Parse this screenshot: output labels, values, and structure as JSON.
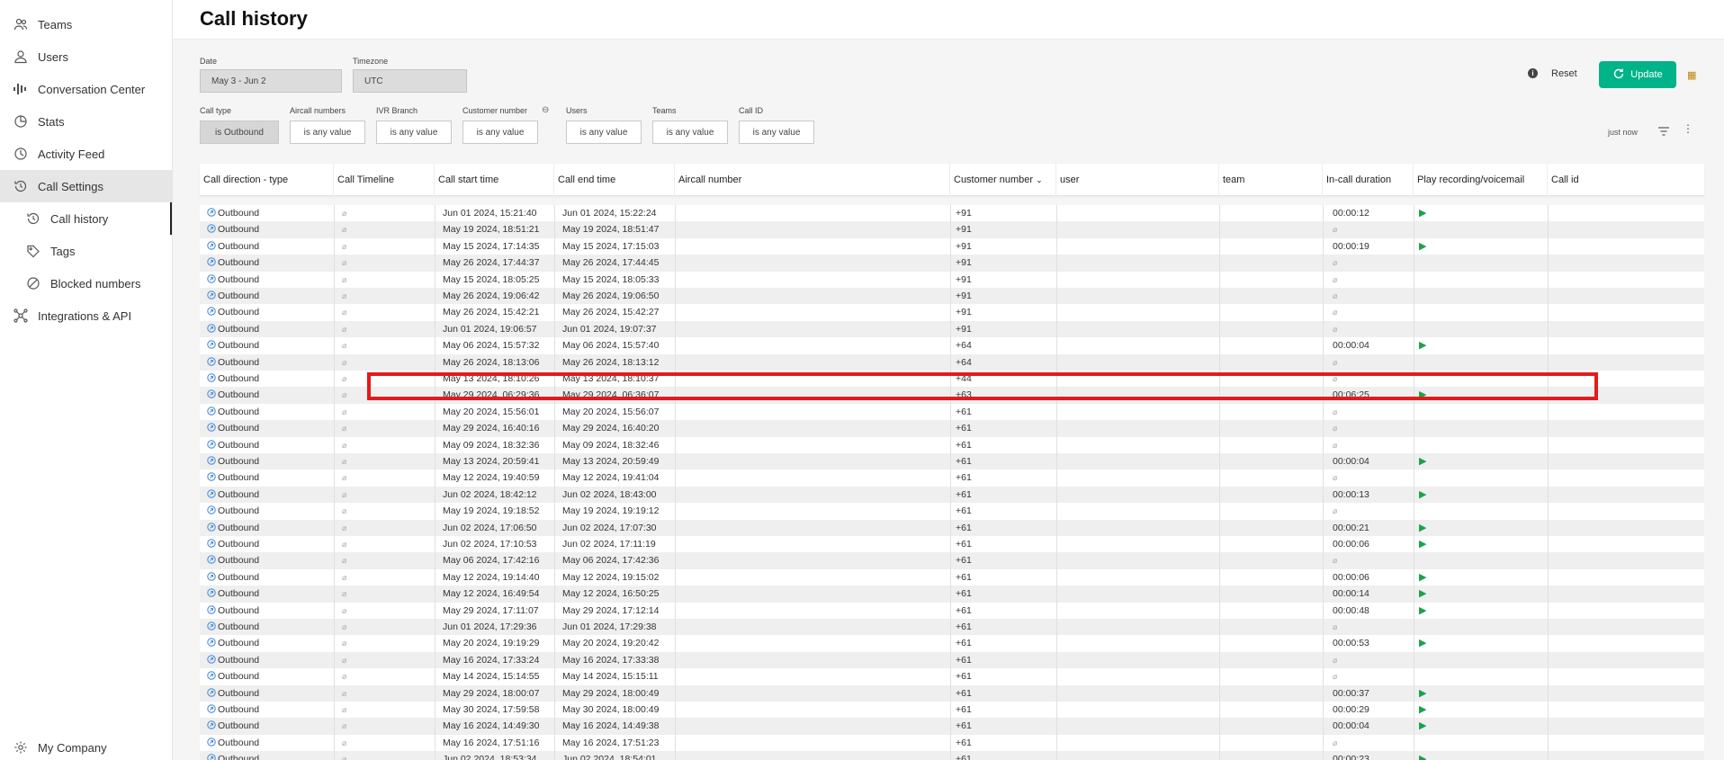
{
  "sidebar": {
    "items": [
      {
        "label": "Teams",
        "icon": "users-group-icon"
      },
      {
        "label": "Users",
        "icon": "user-icon"
      },
      {
        "label": "Conversation Center",
        "icon": "waveform-icon"
      },
      {
        "label": "Stats",
        "icon": "pie-chart-icon"
      },
      {
        "label": "Activity Feed",
        "icon": "activity-icon"
      },
      {
        "label": "Call Settings",
        "icon": "history-icon"
      },
      {
        "label": "Call history",
        "icon": "history-icon"
      },
      {
        "label": "Tags",
        "icon": "tag-icon"
      },
      {
        "label": "Blocked numbers",
        "icon": "block-icon"
      },
      {
        "label": "Integrations & API",
        "icon": "integration-icon"
      }
    ],
    "bottom": {
      "label": "My Company",
      "icon": "gear-icon"
    }
  },
  "header": {
    "title": "Call history"
  },
  "filters": {
    "date_label": "Date",
    "date_value": "May 3 - Jun 2",
    "timezone_label": "Timezone",
    "timezone_value": "UTC",
    "call_type_label": "Call type",
    "call_type_value": "is Outbound",
    "aircall_label": "Aircall numbers",
    "aircall_value": "is any value",
    "ivr_label": "IVR Branch",
    "ivr_value": "is any value",
    "customer_label": "Customer number",
    "customer_value": "is any value",
    "users_label": "Users",
    "users_value": "is any value",
    "teams_label": "Teams",
    "teams_value": "is any value",
    "callid_label": "Call ID",
    "callid_value": "is any value"
  },
  "actions": {
    "reset_label": "Reset",
    "update_label": "Update",
    "refreshed": "just now"
  },
  "columns": [
    "Call direction - type",
    "Call Timeline",
    "Call start time",
    "Call end time",
    "Aircall number",
    "Customer number",
    "user",
    "team",
    "In-call duration",
    "Play recording/voicemail",
    "Call id"
  ],
  "null_glyph": "⌀",
  "rows": [
    {
      "type": "Outbound",
      "start": "Jun 01 2024, 15:21:40",
      "end": "Jun 01 2024, 15:22:24",
      "customer": "+91",
      "duration": "00:00:12",
      "play": true
    },
    {
      "type": "Outbound",
      "start": "May 19 2024, 18:51:21",
      "end": "May 19 2024, 18:51:47",
      "customer": "+91",
      "duration": "",
      "play": false
    },
    {
      "type": "Outbound",
      "start": "May 15 2024, 17:14:35",
      "end": "May 15 2024, 17:15:03",
      "customer": "+91",
      "duration": "00:00:19",
      "play": true
    },
    {
      "type": "Outbound",
      "start": "May 26 2024, 17:44:37",
      "end": "May 26 2024, 17:44:45",
      "customer": "+91",
      "duration": "",
      "play": false
    },
    {
      "type": "Outbound",
      "start": "May 15 2024, 18:05:25",
      "end": "May 15 2024, 18:05:33",
      "customer": "+91",
      "duration": "",
      "play": false
    },
    {
      "type": "Outbound",
      "start": "May 26 2024, 19:06:42",
      "end": "May 26 2024, 19:06:50",
      "customer": "+91",
      "duration": "",
      "play": false
    },
    {
      "type": "Outbound",
      "start": "May 26 2024, 15:42:21",
      "end": "May 26 2024, 15:42:27",
      "customer": "+91",
      "duration": "",
      "play": false
    },
    {
      "type": "Outbound",
      "start": "Jun 01 2024, 19:06:57",
      "end": "Jun 01 2024, 19:07:37",
      "customer": "+91",
      "duration": "",
      "play": false
    },
    {
      "type": "Outbound",
      "start": "May 06 2024, 15:57:32",
      "end": "May 06 2024, 15:57:40",
      "customer": "+64",
      "duration": "00:00:04",
      "play": true
    },
    {
      "type": "Outbound",
      "start": "May 26 2024, 18:13:06",
      "end": "May 26 2024, 18:13:12",
      "customer": "+64",
      "duration": "",
      "play": false
    },
    {
      "type": "Outbound",
      "start": "May 13 2024, 18:10:26",
      "end": "May 13 2024, 18:10:37",
      "customer": "+44",
      "duration": "",
      "play": false
    },
    {
      "type": "Outbound",
      "start": "May 29 2024, 06:29:36",
      "end": "May 29 2024, 06:36:07",
      "customer": "+63",
      "duration": "00:06:25",
      "play": true
    },
    {
      "type": "Outbound",
      "start": "May 20 2024, 15:56:01",
      "end": "May 20 2024, 15:56:07",
      "customer": "+61",
      "duration": "",
      "play": false
    },
    {
      "type": "Outbound",
      "start": "May 29 2024, 16:40:16",
      "end": "May 29 2024, 16:40:20",
      "customer": "+61",
      "duration": "",
      "play": false
    },
    {
      "type": "Outbound",
      "start": "May 09 2024, 18:32:36",
      "end": "May 09 2024, 18:32:46",
      "customer": "+61",
      "duration": "",
      "play": false
    },
    {
      "type": "Outbound",
      "start": "May 13 2024, 20:59:41",
      "end": "May 13 2024, 20:59:49",
      "customer": "+61",
      "duration": "00:00:04",
      "play": true
    },
    {
      "type": "Outbound",
      "start": "May 12 2024, 19:40:59",
      "end": "May 12 2024, 19:41:04",
      "customer": "+61",
      "duration": "",
      "play": false
    },
    {
      "type": "Outbound",
      "start": "Jun 02 2024, 18:42:12",
      "end": "Jun 02 2024, 18:43:00",
      "customer": "+61",
      "duration": "00:00:13",
      "play": true
    },
    {
      "type": "Outbound",
      "start": "May 19 2024, 19:18:52",
      "end": "May 19 2024, 19:19:12",
      "customer": "+61",
      "duration": "",
      "play": false
    },
    {
      "type": "Outbound",
      "start": "Jun 02 2024, 17:06:50",
      "end": "Jun 02 2024, 17:07:30",
      "customer": "+61",
      "duration": "00:00:21",
      "play": true
    },
    {
      "type": "Outbound",
      "start": "Jun 02 2024, 17:10:53",
      "end": "Jun 02 2024, 17:11:19",
      "customer": "+61",
      "duration": "00:00:06",
      "play": true
    },
    {
      "type": "Outbound",
      "start": "May 06 2024, 17:42:16",
      "end": "May 06 2024, 17:42:36",
      "customer": "+61",
      "duration": "",
      "play": false
    },
    {
      "type": "Outbound",
      "start": "May 12 2024, 19:14:40",
      "end": "May 12 2024, 19:15:02",
      "customer": "+61",
      "duration": "00:00:06",
      "play": true
    },
    {
      "type": "Outbound",
      "start": "May 12 2024, 16:49:54",
      "end": "May 12 2024, 16:50:25",
      "customer": "+61",
      "duration": "00:00:14",
      "play": true
    },
    {
      "type": "Outbound",
      "start": "May 29 2024, 17:11:07",
      "end": "May 29 2024, 17:12:14",
      "customer": "+61",
      "duration": "00:00:48",
      "play": true
    },
    {
      "type": "Outbound",
      "start": "Jun 01 2024, 17:29:36",
      "end": "Jun 01 2024, 17:29:38",
      "customer": "+61",
      "duration": "",
      "play": false
    },
    {
      "type": "Outbound",
      "start": "May 20 2024, 19:19:29",
      "end": "May 20 2024, 19:20:42",
      "customer": "+61",
      "duration": "00:00:53",
      "play": true
    },
    {
      "type": "Outbound",
      "start": "May 16 2024, 17:33:24",
      "end": "May 16 2024, 17:33:38",
      "customer": "+61",
      "duration": "",
      "play": false
    },
    {
      "type": "Outbound",
      "start": "May 14 2024, 15:14:55",
      "end": "May 14 2024, 15:15:11",
      "customer": "+61",
      "duration": "",
      "play": false
    },
    {
      "type": "Outbound",
      "start": "May 29 2024, 18:00:07",
      "end": "May 29 2024, 18:00:49",
      "customer": "+61",
      "duration": "00:00:37",
      "play": true
    },
    {
      "type": "Outbound",
      "start": "May 30 2024, 17:59:58",
      "end": "May 30 2024, 18:00:49",
      "customer": "+61",
      "duration": "00:00:29",
      "play": true
    },
    {
      "type": "Outbound",
      "start": "May 16 2024, 14:49:30",
      "end": "May 16 2024, 14:49:38",
      "customer": "+61",
      "duration": "00:00:04",
      "play": true
    },
    {
      "type": "Outbound",
      "start": "May 16 2024, 17:51:16",
      "end": "May 16 2024, 17:51:23",
      "customer": "+61",
      "duration": "",
      "play": false
    },
    {
      "type": "Outbound",
      "start": "Jun 02 2024, 18:53:34",
      "end": "Jun 02 2024, 18:54:01",
      "customer": "+61",
      "duration": "00:00:23",
      "play": true
    }
  ],
  "colors": {
    "accent": "#00b388",
    "highlight": "#e31b1b",
    "play": "#17a34a"
  }
}
